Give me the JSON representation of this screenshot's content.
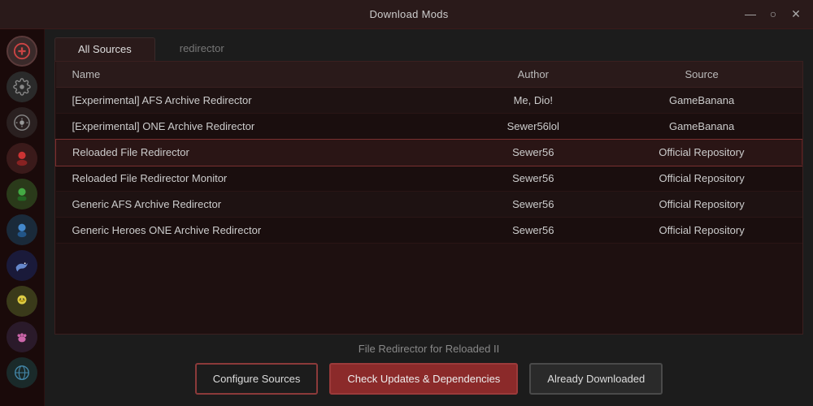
{
  "titleBar": {
    "title": "Download Mods",
    "minimizeBtn": "—",
    "maximizeBtn": "○",
    "closeBtn": "✕"
  },
  "tabs": [
    {
      "label": "All Sources",
      "active": true
    },
    {
      "label": "redirector",
      "active": false
    }
  ],
  "table": {
    "columns": [
      "Name",
      "Author",
      "Source"
    ],
    "rows": [
      {
        "name": "[Experimental] AFS Archive Redirector",
        "author": "Me, Dio!",
        "source": "GameBanana",
        "selected": false
      },
      {
        "name": "[Experimental] ONE Archive Redirector",
        "author": "Sewer56lol",
        "source": "GameBanana",
        "selected": false
      },
      {
        "name": "Reloaded File Redirector",
        "author": "Sewer56",
        "source": "Official Repository",
        "selected": true
      },
      {
        "name": "Reloaded File Redirector Monitor",
        "author": "Sewer56",
        "source": "Official Repository",
        "selected": false
      },
      {
        "name": "Generic AFS Archive Redirector",
        "author": "Sewer56",
        "source": "Official Repository",
        "selected": false
      },
      {
        "name": "Generic Heroes ONE Archive Redirector",
        "author": "Sewer56",
        "source": "Official Repository",
        "selected": false
      }
    ]
  },
  "footer": {
    "label": "File Redirector for Reloaded II",
    "buttons": {
      "configure": "Configure Sources",
      "checkUpdates": "Check Updates & Dependencies",
      "alreadyDownloaded": "Already Downloaded"
    }
  },
  "sidebar": {
    "icons": [
      "add-icon",
      "gear-icon",
      "settings-icon",
      "character1-icon",
      "character2-icon",
      "character3-icon",
      "dolphin-icon",
      "character4-icon",
      "paw-icon",
      "globe-icon"
    ]
  }
}
